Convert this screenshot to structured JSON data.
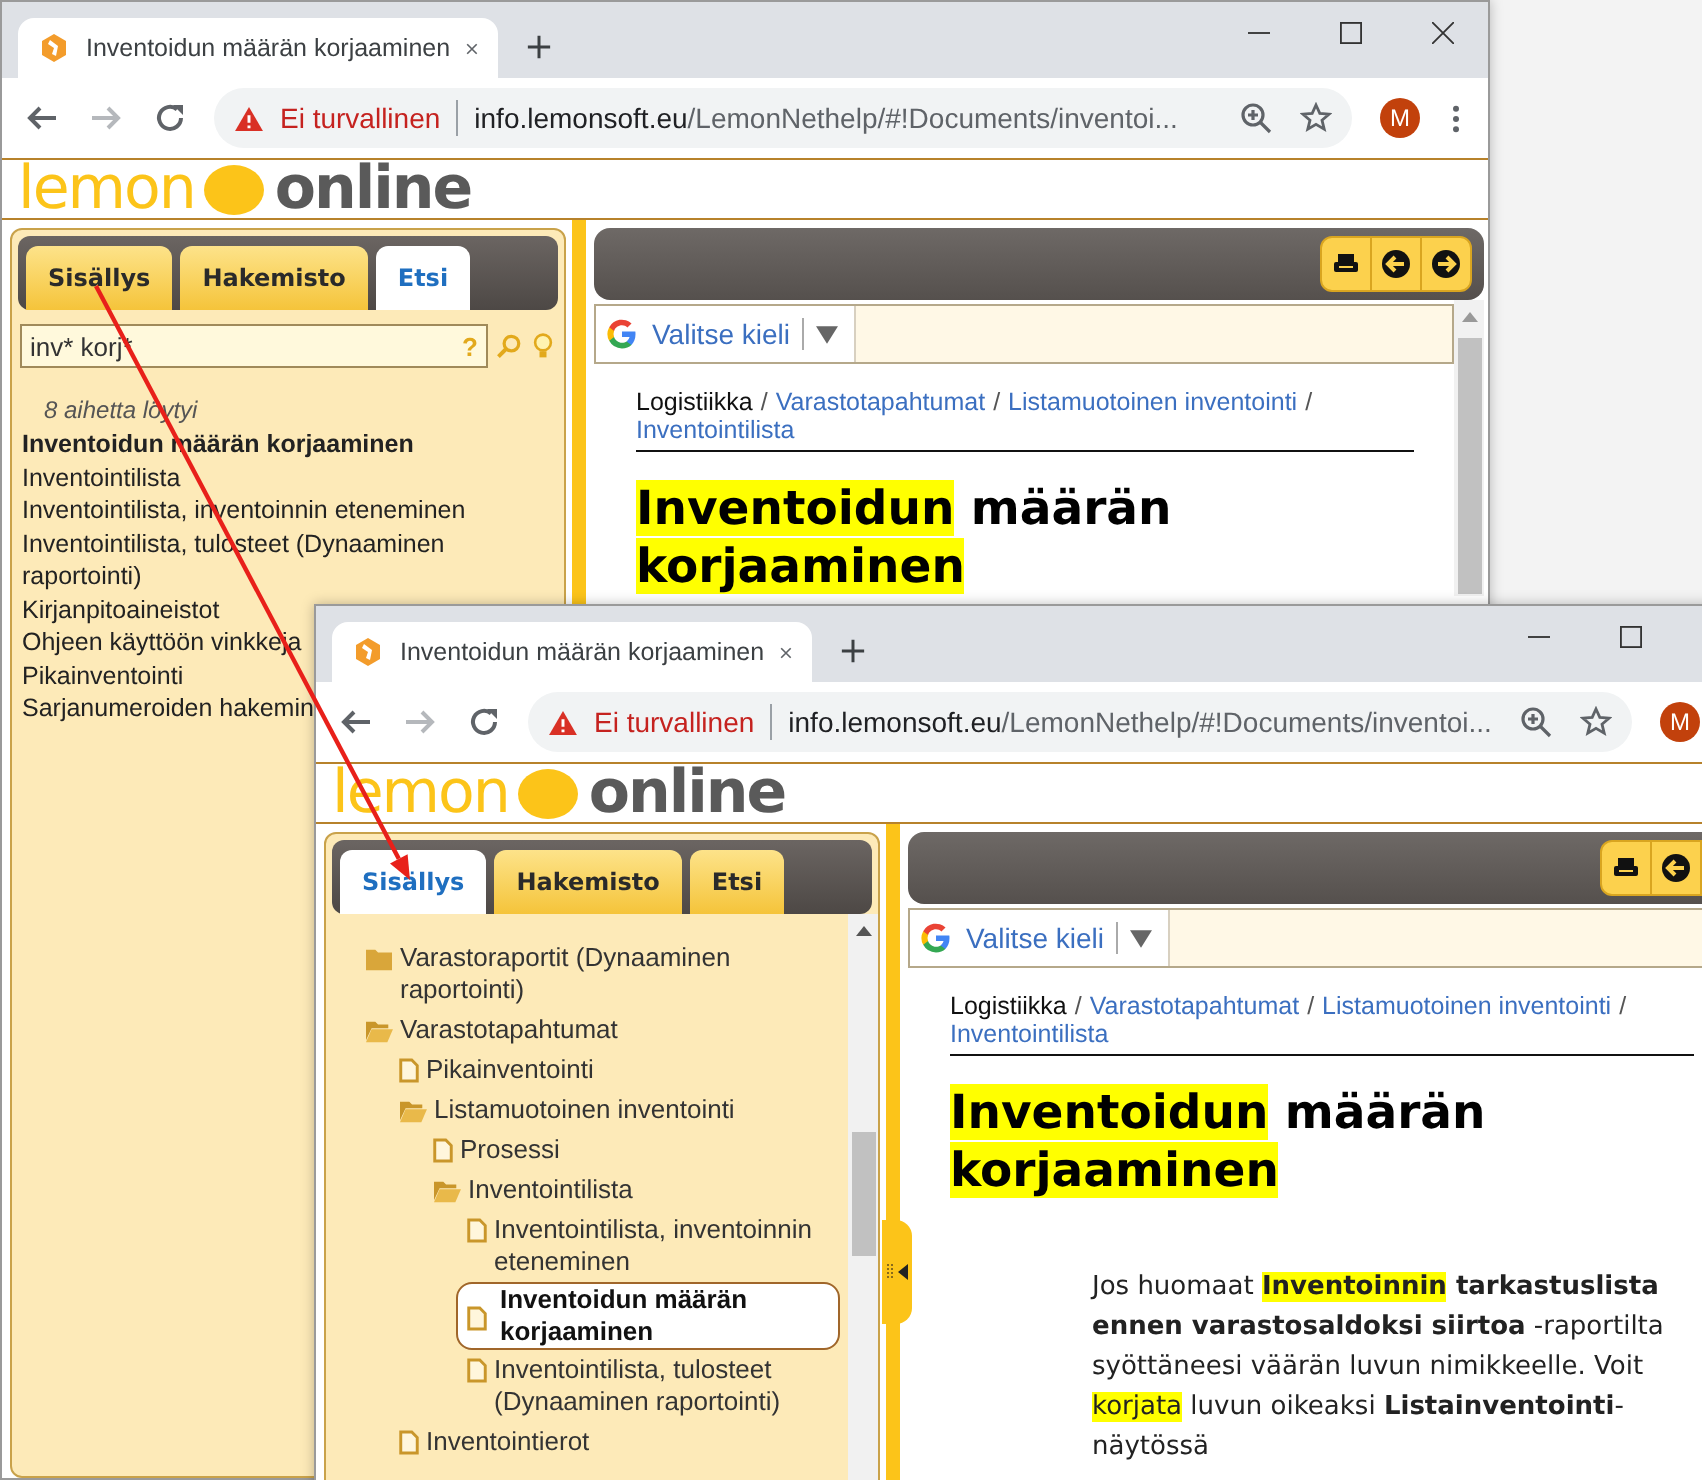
{
  "windows": [
    {
      "tab_title": "Inventoidun määrän korjaaminen",
      "security_label": "Ei turvallinen",
      "url": {
        "host": "info.lemonsoft.eu",
        "path": "/LemonNethelp/#!Documents/inventoi..."
      },
      "avatar": "M",
      "logo": [
        "lemon",
        "online"
      ],
      "help_tabs": [
        {
          "label": "Sisällys",
          "selected": false
        },
        {
          "label": "Hakemisto",
          "selected": false
        },
        {
          "label": "Etsi",
          "selected": true
        }
      ],
      "sidebar": {
        "kind": "search",
        "query": "inv* korj*",
        "help_mark": "?",
        "result_count": "8 aihetta löytyi",
        "results": [
          {
            "label": "Inventoidun määrän korjaaminen",
            "selected": true
          },
          {
            "label": "Inventointilista",
            "selected": false
          },
          {
            "label": "Inventointilista, inventoinnin eteneminen",
            "selected": false
          },
          {
            "label": "Inventointilista, tulosteet (Dynaaminen raportointi)",
            "selected": false
          },
          {
            "label": "Kirjanpitoaineistot",
            "selected": false
          },
          {
            "label": "Ohjeen käyttöön vinkkeja",
            "selected": false
          },
          {
            "label": "Pikainventointi",
            "selected": false
          },
          {
            "label": "Sarjanumeroiden hakemin",
            "selected": false
          }
        ]
      },
      "translate_label": "Valitse kieli",
      "breadcrumb": [
        {
          "label": "Logistiikka",
          "link": false,
          "separator": "/"
        },
        {
          "label": "Varastotapahtumat",
          "link": true,
          "separator": "/"
        },
        {
          "label": "Listamuotoinen inventointi",
          "link": true,
          "separator": "/"
        },
        {
          "label": "Inventointilista",
          "link": true
        }
      ],
      "heading": [
        {
          "text": "Inventoidun",
          "highlighted": true
        },
        {
          "text": " määrän ",
          "highlighted": false
        },
        {
          "text": "korjaaminen",
          "highlighted": true
        }
      ]
    },
    {
      "tab_title": "Inventoidun määrän korjaaminen",
      "security_label": "Ei turvallinen",
      "url": {
        "host": "info.lemonsoft.eu",
        "path": "/LemonNethelp/#!Documents/inventoi..."
      },
      "avatar": "M",
      "logo": [
        "lemon",
        "online"
      ],
      "help_tabs": [
        {
          "label": "Sisällys",
          "selected": true
        },
        {
          "label": "Hakemisto",
          "selected": false
        },
        {
          "label": "Etsi",
          "selected": false
        }
      ],
      "sidebar": {
        "kind": "tree",
        "items": [
          {
            "kind": "folder",
            "label": "Varastoraportit (Dynaaminen raportointi)",
            "expanded": false,
            "selected": false
          },
          {
            "kind": "folder",
            "label": "Varastotapahtumat",
            "expanded": true,
            "selected": false,
            "children": [
              {
                "kind": "page",
                "label": "Pikainventointi",
                "selected": false
              },
              {
                "kind": "folder",
                "label": "Listamuotoinen inventointi",
                "expanded": true,
                "selected": false,
                "children": [
                  {
                    "kind": "page",
                    "label": "Prosessi",
                    "selected": false
                  },
                  {
                    "kind": "folder",
                    "label": "Inventointilista",
                    "expanded": true,
                    "selected": false,
                    "children": [
                      {
                        "kind": "page",
                        "label": "Inventointilista, inventoinnin eteneminen",
                        "selected": false
                      },
                      {
                        "kind": "page",
                        "label": "Inventoidun määrän korjaaminen",
                        "selected": true
                      },
                      {
                        "kind": "page",
                        "label": "Inventointilista, tulosteet (Dynaaminen raportointi)",
                        "selected": false
                      }
                    ]
                  }
                ]
              },
              {
                "kind": "page",
                "label": "Inventointierot",
                "selected": false
              }
            ]
          }
        ]
      },
      "translate_label": "Valitse kieli",
      "breadcrumb": [
        {
          "label": "Logistiikka",
          "link": false,
          "separator": "/"
        },
        {
          "label": "Varastotapahtumat",
          "link": true,
          "separator": "/"
        },
        {
          "label": "Listamuotoinen inventointi",
          "link": true,
          "separator": "/"
        },
        {
          "label": "Inventointilista",
          "link": true
        }
      ],
      "heading": [
        {
          "text": "Inventoidun",
          "highlighted": true
        },
        {
          "text": " määrän ",
          "highlighted": false
        },
        {
          "text": "korjaaminen",
          "highlighted": true
        }
      ],
      "body": [
        {
          "text": "Jos huomaat ",
          "bold": false,
          "highlighted": false
        },
        {
          "text": "Inventoinnin",
          "bold": true,
          "highlighted": true
        },
        {
          "text": " tarkastuslista ennen varastosaldoksi siirtoa",
          "bold": true,
          "highlighted": false
        },
        {
          "text": " -raportilta syöttäneesi väärän luvun nimikkeelle. Voit ",
          "bold": false,
          "highlighted": false
        },
        {
          "text": "korjata",
          "bold": false,
          "highlighted": true
        },
        {
          "text": " luvun oikeaksi ",
          "bold": false,
          "highlighted": false
        },
        {
          "text": "Listainventointi",
          "bold": true,
          "highlighted": false
        },
        {
          "text": "-näytössä",
          "bold": false,
          "highlighted": false
        }
      ]
    }
  ]
}
